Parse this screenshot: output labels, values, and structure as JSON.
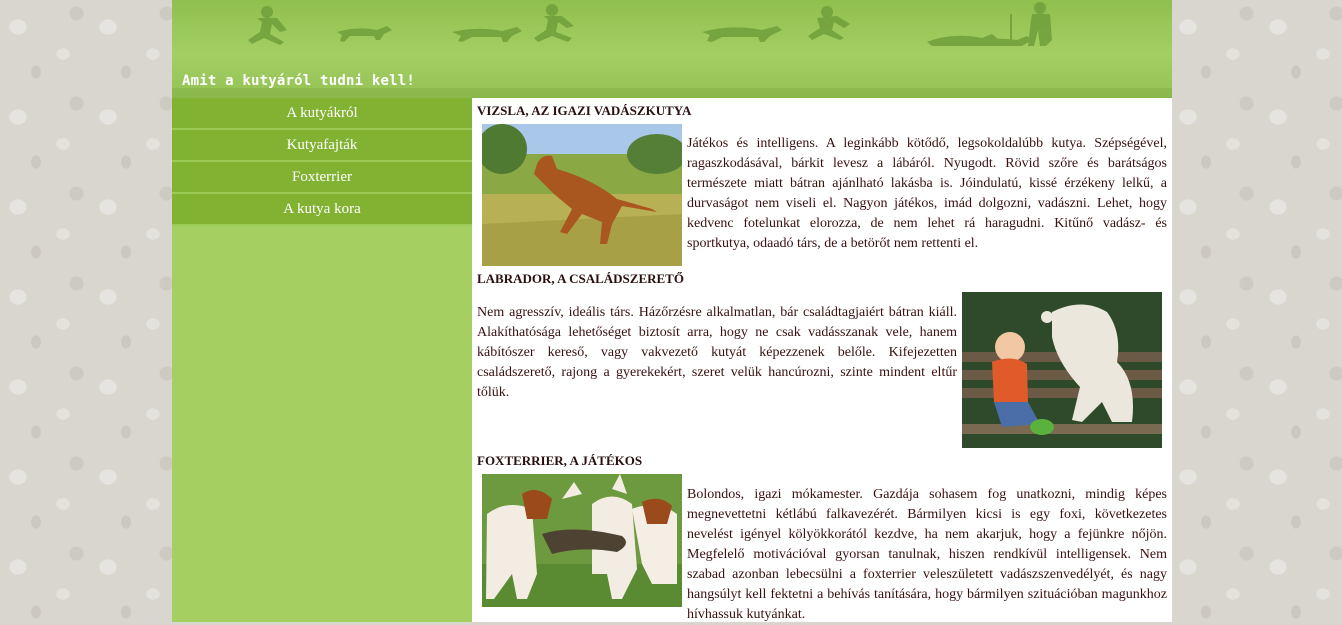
{
  "header": {
    "title": "Amit a kutyáról tudni kell!"
  },
  "sidebar": {
    "items": [
      {
        "label": "A kutyákról"
      },
      {
        "label": "Kutyafajták"
      },
      {
        "label": "Foxterrier"
      },
      {
        "label": "A kutya kora"
      }
    ]
  },
  "sections": [
    {
      "heading": "VIZSLA, AZ IGAZI VADÁSZKUTYA",
      "text": "Játékos és intelligens. A leginkább kötődő, legsokoldalúbb kutya. Szépségével, ragaszkodásával, bárkit levesz a lábáról. Nyugodt. Rövid szőre és barátságos természete miatt bátran ajánlható lakásba is. Jóindulatú, kissé érzékeny lelkű, a durvaságot nem viseli el. Nagyon játékos, imád dolgozni, vadászni. Lehet, hogy kedvenc fotelunkat elorozza, de nem lehet rá haragudni. Kitűnő vadász- és sportkutya, odaadó társ, de a betörőt nem rettenti el."
    },
    {
      "heading": "LABRADOR, A CSALÁDSZERETŐ",
      "text": "Nem agresszív, ideális társ. Házőrzésre alkalmatlan, bár családtagjaiért bátran kiáll. Alakíthatósága lehetőséget biztosít arra, hogy ne csak vadásszanak vele, hanem kábítószer kereső, vagy vakvezető kutyát képezzenek belőle. Kifejezetten családszerető, rajong a gyerekekért, szeret velük hancúrozni, szinte mindent eltűr tőlük."
    },
    {
      "heading": "FOXTERRIER, A JÁTÉKOS",
      "text": "Bolondos, igazi mókamester. Gazdája sohasem fog unatkozni, mindig képes megnevettetni kétlábú falkavezérét. Bármilyen kicsi is egy foxi, következetes nevelést igényel kölyökkorától kezdve, ha nem akarjuk, hogy a fejünkre nőjön. Megfelelő motivációval gyorsan tanulnak, hiszen rendkívül intelligensek. Nem szabad azonban lebecsülni a foxterrier veleszületett vadászszenvedélyét, és nagy hangsúlyt kell fektetni a behívás tanítására, hogy bármilyen szituációban magunkhoz hívhassuk kutyánkat."
    }
  ],
  "colors": {
    "header_green": "#a4cf63",
    "nav_green": "#82b232",
    "sidebar_green": "#a6cf62",
    "text_brown": "#3a0f0f"
  }
}
